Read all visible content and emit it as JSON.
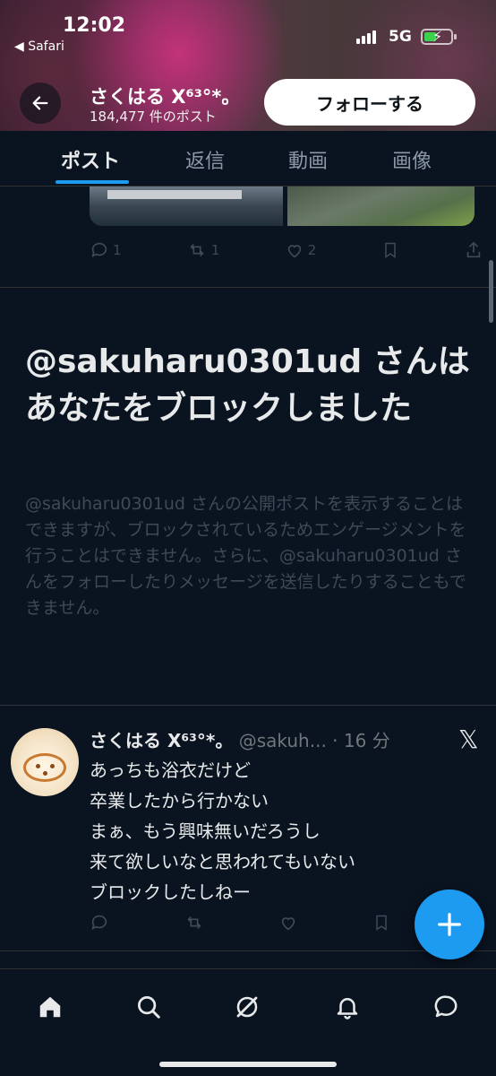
{
  "status": {
    "time": "12:02",
    "back_app": "◀ Safari",
    "network": "5G"
  },
  "header": {
    "name": "さくはる X⁶³°*。",
    "post_count": "184,477 件のポスト",
    "follow_label": "フォローする"
  },
  "tabs": [
    {
      "label": "ポスト",
      "active": true
    },
    {
      "label": "返信",
      "active": false
    },
    {
      "label": "動画",
      "active": false
    },
    {
      "label": "画像",
      "active": false
    }
  ],
  "prev_post": {
    "reply_count": "1",
    "repost_count": "1",
    "like_count": "2"
  },
  "block_notice": {
    "title": "@sakuharu0301ud さんはあなたをブロックしました",
    "description": "@sakuharu0301ud さんの公開ポストを表示することはできますが、ブロックされているためエンゲージメントを行うことはできません。さらに、@sakuharu0301ud さんをフォローしたりメッセージを送信したりすることもできません。"
  },
  "tweet": {
    "name": "さくはる X⁶³°*。",
    "handle": "@sakuh...",
    "time": "· 16 分",
    "lines": [
      "あっちも浴衣だけど",
      "卒業したから行かない",
      "まぁ、もう興味無いだろうし",
      "来て欲しいなと思われてもいない",
      "ブロックしたしねー"
    ]
  },
  "colors": {
    "accent": "#1d9bf0",
    "background": "#0a1320",
    "muted": "#3e4a56"
  },
  "nav": [
    "home-icon",
    "search-icon",
    "grok-icon",
    "notifications-icon",
    "messages-icon"
  ]
}
